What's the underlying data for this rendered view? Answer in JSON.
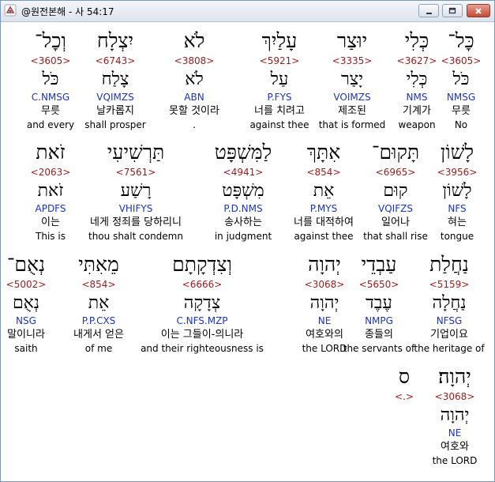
{
  "window": {
    "title": "@원전본해 - 사 54:17"
  },
  "rows": [
    [
      {
        "hebrew": "כׇּל־",
        "strong": "<3605>",
        "lemma": "כֹּל",
        "morph": "NMSG",
        "korean": "무릇",
        "english": "No"
      },
      {
        "hebrew": "כְּלִי",
        "strong": "<3627>",
        "lemma": "כְּלִי",
        "morph": "NMS",
        "korean": "기계가",
        "english": "weapon"
      },
      {
        "hebrew": "יוּצַר",
        "strong": "<3335>",
        "lemma": "יָצַר",
        "morph": "VOIMZS",
        "korean": "제조된",
        "english": "that is formed"
      },
      {
        "hebrew": "עָלַיִךְ",
        "strong": "<5921>",
        "lemma": "עַל",
        "morph": "P.FYS",
        "korean": "너를 치려고",
        "english": "against thee"
      },
      {
        "hebrew": "לֹא",
        "strong": "<3808>",
        "lemma": "לֹא",
        "morph": "ABN",
        "korean": "못할 것이라",
        "english": "."
      },
      {
        "hebrew": "יִצְלָח",
        "strong": "<6743>",
        "lemma": "צָלַח",
        "morph": "VQIMZS",
        "korean": "날카롭지",
        "english": "shall prosper"
      },
      {
        "hebrew": "וְכׇל־",
        "strong": "<3605>",
        "lemma": "כֹּל",
        "morph": "C.NMSG",
        "korean": "무릇",
        "english": "and every"
      }
    ],
    [
      {
        "hebrew": "לָשׁוֹן",
        "strong": "<3956>",
        "lemma": "לָשׁוֹן",
        "morph": "NFS",
        "korean": "혀는",
        "english": "tongue"
      },
      {
        "hebrew": "תָּקוּם־",
        "strong": "<6965>",
        "lemma": "קוּם",
        "morph": "VQIFZS",
        "korean": "일어나",
        "english": "that shall rise"
      },
      {
        "hebrew": "אִתָּךְ",
        "strong": "<854>",
        "lemma": "אֵת",
        "morph": "P.MYS",
        "korean": "너를 대적하여",
        "english": "against thee"
      },
      {
        "hebrew": "לַמִּשְׁפָּט",
        "strong": "<4941>",
        "lemma": "מִשְׁפָּט",
        "morph": "P.D.NMS",
        "korean": "송사하는",
        "english": "in judgment"
      },
      {
        "hebrew": "תַּרְשִׁיעִי",
        "strong": "<7561>",
        "lemma": "רָשַׁע",
        "morph": "VHIFYS",
        "korean": "네게 정죄를 당하리니",
        "english": "thou shalt condemn"
      },
      {
        "hebrew": "זֹאת",
        "strong": "<2063>",
        "lemma": "זֹאת",
        "morph": "APDFS",
        "korean": "이는",
        "english": "This is"
      }
    ],
    [
      {
        "hebrew": "נַחֲלַת",
        "strong": "<5159>",
        "lemma": "נַחֲלָה",
        "morph": "NFSG",
        "korean": "기업이요",
        "english": "the heritage of"
      },
      {
        "hebrew": "עַבְדֵי",
        "strong": "<5650>",
        "lemma": "עֶבֶד",
        "morph": "NMPG",
        "korean": "종들의",
        "english": "the servants of"
      },
      {
        "hebrew": "יְהוָה",
        "strong": "<3068>",
        "lemma": "יְהוָה",
        "morph": "NE",
        "korean": "여호와의",
        "english": "the LORD"
      },
      {
        "hebrew": "וְצִדְקָתָם",
        "strong": "<6666>",
        "lemma": "צְדָקָה",
        "morph": "C.NFS.MZP",
        "korean": "이는 그들이-의니라",
        "english": "and their righteousness is"
      },
      {
        "hebrew": "מֵאִתִּי",
        "strong": "<854>",
        "lemma": "אֵת",
        "morph": "P.P.CXS",
        "korean": "내게서 얻은",
        "english": "of me"
      },
      {
        "hebrew": "נְאֻם־",
        "strong": "<5002>",
        "lemma": "נְאֻם",
        "morph": "NSG",
        "korean": "말이니라",
        "english": "saith"
      }
    ],
    [
      {
        "hebrew": "יְהוָה׃",
        "strong": "<3068>",
        "lemma": "יְהוָה",
        "morph": "NE",
        "korean": "여호와",
        "english": "the LORD"
      },
      {
        "hebrew": "ס",
        "strong": "<.>",
        "lemma": "",
        "morph": "",
        "korean": "",
        "english": ""
      }
    ]
  ]
}
